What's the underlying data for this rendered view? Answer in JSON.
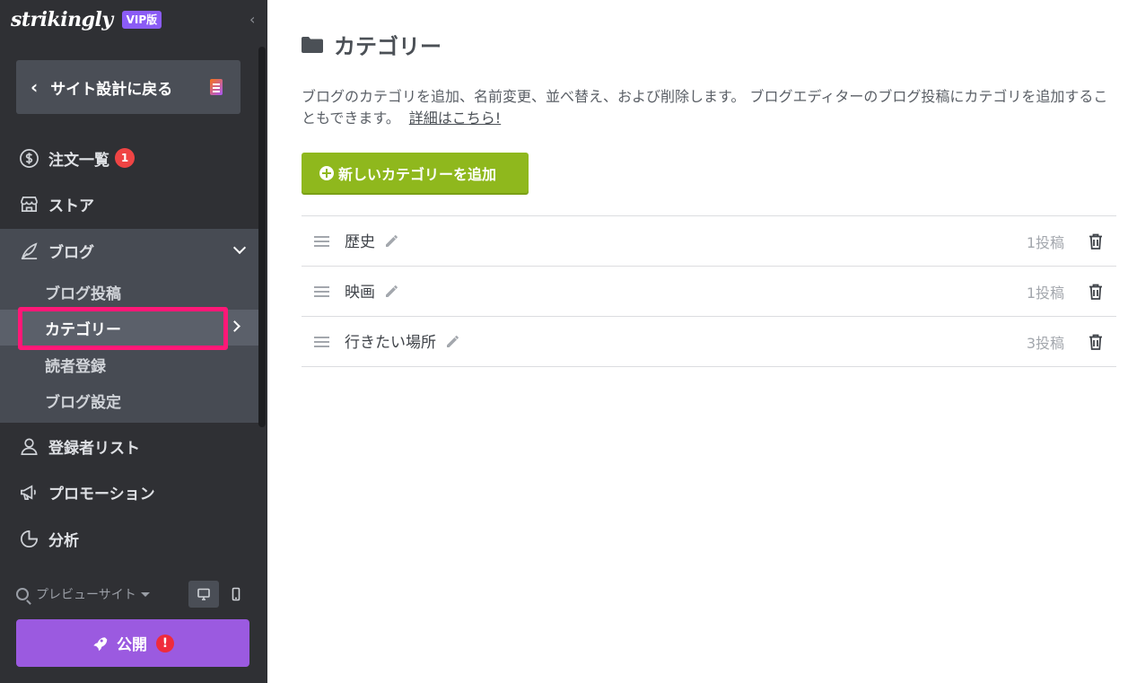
{
  "brand": {
    "logo": "strikingly",
    "vip": "VIP版"
  },
  "sidebar": {
    "back_label": "サイト設計に戻る",
    "nav": [
      {
        "label": "注文一覧",
        "badge": "1"
      },
      {
        "label": "ストア"
      },
      {
        "label": "ブログ"
      },
      {
        "label": "登録者リスト"
      },
      {
        "label": "プロモーション"
      },
      {
        "label": "分析"
      }
    ],
    "blog_sub": [
      "ブログ投稿",
      "カテゴリー",
      "読者登録",
      "ブログ設定"
    ],
    "preview_label": "プレビューサイト",
    "publish_label": "公開",
    "publish_alert": "!"
  },
  "main": {
    "title": "カテゴリー",
    "description": "ブログのカテゴリを追加、名前変更、並べ替え、および削除します。 ブログエディターのブログ投稿にカテゴリを追加することもできます。",
    "details_link": "詳細はこちら!",
    "add_button": "新しいカテゴリーを追加",
    "categories": [
      {
        "name": "歴史",
        "count": "1投稿"
      },
      {
        "name": "映画",
        "count": "1投稿"
      },
      {
        "name": "行きたい場所",
        "count": "3投稿"
      }
    ]
  },
  "colors": {
    "sidebar_bg": "#2f3034",
    "vip": "#8b5cf6",
    "publish": "#9b5ae0",
    "add_button": "#8fb81d",
    "highlight": "#ff1877",
    "badge": "#ef4444"
  },
  "icons": {
    "orders": "dollar-circle-icon",
    "store": "store-icon",
    "blog": "quill-icon",
    "subscribers": "users-icon",
    "promotion": "megaphone-icon",
    "analytics": "pie-chart-icon",
    "edit": "pencil-icon",
    "delete": "trash-icon",
    "drag": "drag-handle-icon"
  }
}
